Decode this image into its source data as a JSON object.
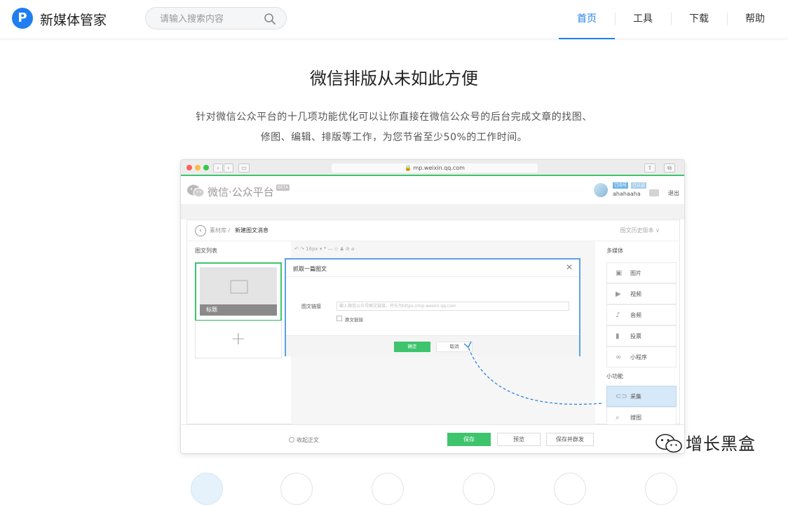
{
  "header": {
    "logo_letter": "P",
    "app_title": "新媒体管家",
    "search_placeholder": "请输入搜索内容",
    "nav": [
      {
        "label": "首页",
        "active": true
      },
      {
        "label": "工具",
        "active": false
      },
      {
        "label": "下载",
        "active": false
      },
      {
        "label": "帮助",
        "active": false
      }
    ]
  },
  "hero": {
    "headline": "微信排版从未如此方便",
    "description_line1": "针对微信公众平台的十几项功能优化可以让你直接在微信公众号的后台完成文章的找图、",
    "description_line2": "修图、编辑、排版等工作，为您节省至少50%的工作时间。"
  },
  "mock": {
    "url": "mp.weixin.qq.com",
    "platform_name": "微信·公众平台",
    "account_tag_1": "订阅号",
    "account_tag_2": "已认证",
    "account_name": "ahahaaha",
    "logout": "退出",
    "breadcrumb_root": "素材库 /",
    "breadcrumb_current": "新建图文消息",
    "history_version": "图文历史版本 ∨",
    "list_title": "图文列表",
    "article_caption": "标题",
    "toolbar_text": "↶  ↷     16px ▾     ❝  —  ◇  ♟  ⊘  ⌀",
    "multimedia_title": "多媒体",
    "multimedia_items": [
      "图片",
      "视频",
      "音频",
      "投票",
      "小程序"
    ],
    "tools_title": "小功能",
    "tools_items": [
      "采集",
      "搜图"
    ],
    "collapse_label": "收起正文",
    "save_label": "保存",
    "preview_label": "预览",
    "publish_label": "保存并群发",
    "modal": {
      "title": "抓取一篇图文",
      "field_label": "图文链接",
      "field_placeholder": "输入微信公众号图文链接，开头为https://mp.weixin.qq.com",
      "checkbox_label": "原文链接",
      "ok": "确定",
      "cancel": "取消"
    }
  },
  "watermark": {
    "text": "增长黑盒"
  },
  "colors": {
    "accent": "#1f7ff0",
    "wechat_green": "#3ec46d",
    "modal_border": "#5aa3e6"
  }
}
